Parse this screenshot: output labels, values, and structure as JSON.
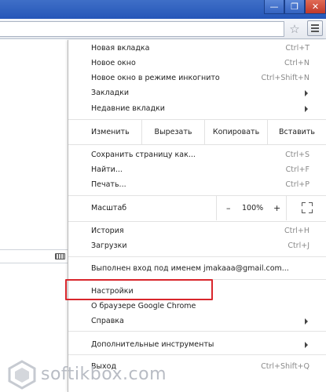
{
  "window": {
    "minimize_glyph": "—",
    "maximize_glyph": "❐",
    "close_glyph": "✕"
  },
  "toolbar": {
    "star_icon": "star-icon",
    "menu_icon": "hamburger-menu-icon"
  },
  "menu": {
    "new_tab": {
      "label": "Новая вкладка",
      "shortcut": "Ctrl+T"
    },
    "new_window": {
      "label": "Новое окно",
      "shortcut": "Ctrl+N"
    },
    "incognito": {
      "label": "Новое окно в режиме инкогнито",
      "shortcut": "Ctrl+Shift+N"
    },
    "bookmarks": {
      "label": "Закладки"
    },
    "recent_tabs": {
      "label": "Недавние вкладки"
    },
    "edit": {
      "label": "Изменить",
      "cut": "Вырезать",
      "copy": "Копировать",
      "paste": "Вставить"
    },
    "save_page": {
      "label": "Сохранить страницу как...",
      "shortcut": "Ctrl+S"
    },
    "find": {
      "label": "Найти...",
      "shortcut": "Ctrl+F"
    },
    "print": {
      "label": "Печать...",
      "shortcut": "Ctrl+P"
    },
    "zoom": {
      "label": "Масштаб",
      "minus": "–",
      "value": "100%",
      "plus": "+"
    },
    "history": {
      "label": "История",
      "shortcut": "Ctrl+H"
    },
    "downloads": {
      "label": "Загрузки",
      "shortcut": "Ctrl+J"
    },
    "signed_in": {
      "label": "Выполнен вход под именем jmakaaa@gmail.com..."
    },
    "settings": {
      "label": "Настройки"
    },
    "about": {
      "label": "О браузере Google Chrome"
    },
    "help": {
      "label": "Справка"
    },
    "more_tools": {
      "label": "Дополнительные инструменты"
    },
    "exit": {
      "label": "Выход",
      "shortcut": "Ctrl+Shift+Q"
    }
  },
  "watermark": {
    "text": "softikbox.com"
  },
  "colors": {
    "highlight": "#d9262c",
    "title_bar": "#2f60bd"
  }
}
